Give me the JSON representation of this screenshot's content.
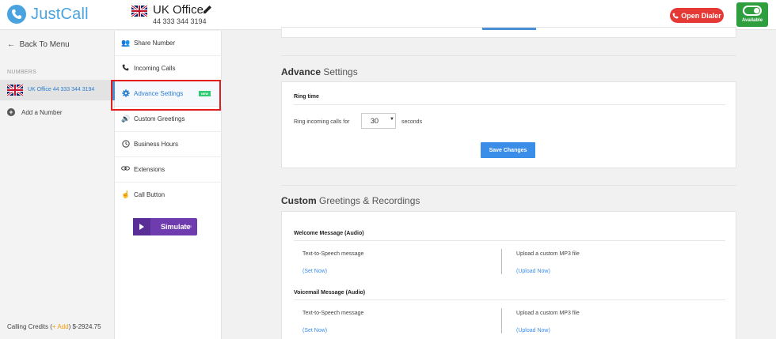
{
  "topbar": {
    "logo_text": "JustCall",
    "office_title": "UK Office",
    "office_number": "44 333 344 3194",
    "open_dialer_label": "Open Dialer",
    "availability_label": "Available"
  },
  "left_sidebar": {
    "back_label": "Back To Menu",
    "numbers_header": "NUMBERS",
    "number_item": "UK Office   44 333 344 3194",
    "add_number_label": "Add a Number",
    "credits_prefix": "Calling Credits (",
    "credits_add": "+ Add",
    "credits_suffix": ")   $-2924.75"
  },
  "menu": {
    "items": [
      {
        "label": "Share Number",
        "icon": "people-icon"
      },
      {
        "label": "Incoming Calls",
        "icon": "phone-icon"
      },
      {
        "label": "Advance Settings",
        "icon": "gear-icon",
        "badge": "NEW",
        "active": true
      },
      {
        "label": "Custom Greetings",
        "icon": "speaker-icon"
      },
      {
        "label": "Business Hours",
        "icon": "clock-icon"
      },
      {
        "label": "Extensions",
        "icon": "link-icon"
      },
      {
        "label": "Call Button",
        "icon": "pointer-icon"
      }
    ],
    "simulate_label": "Simulate",
    "simulate_badge": "beta"
  },
  "advance_settings": {
    "title_bold": "Advance",
    "title_rest": " Settings",
    "ring_time_heading": "Ring time",
    "ring_prefix": "Ring incoming calls for",
    "ring_value": "30",
    "ring_suffix": "seconds",
    "save_label": "Save Changes"
  },
  "greetings": {
    "title_bold": "Custom",
    "title_rest": " Greetings & Recordings",
    "messages": [
      {
        "heading": "Welcome Message (Audio)",
        "tts_label": "Text-to-Speech message",
        "tts_link": "(Set Now)",
        "upload_label": "Upload a custom MP3 file",
        "upload_link": "(Upload Now)"
      },
      {
        "heading": "Voicemail Message (Audio)",
        "tts_label": "Text-to-Speech message",
        "tts_link": "(Set Now)",
        "upload_label": "Upload a custom MP3 file",
        "upload_link": "(Upload Now)"
      }
    ]
  },
  "colors": {
    "brand": "#4aa3df",
    "accent_blue": "#3b8ee8",
    "danger": "#e53935",
    "available_green": "#2e9e3e",
    "simulate_purple": "#6f3cb0"
  }
}
